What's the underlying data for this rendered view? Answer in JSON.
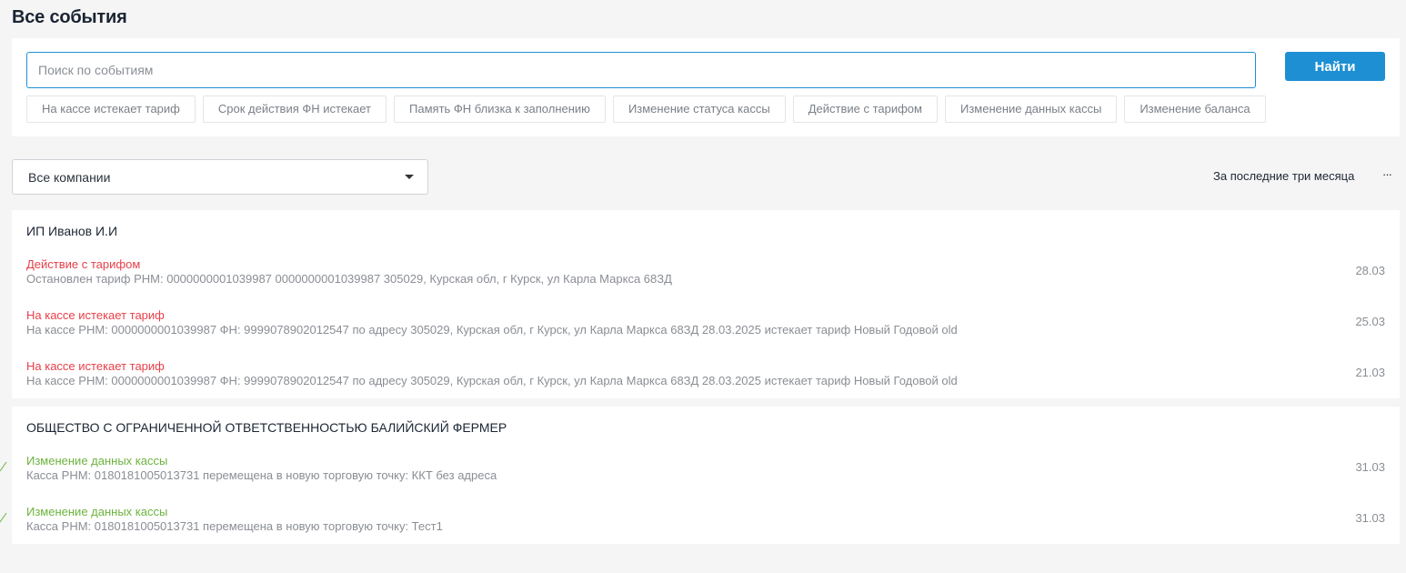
{
  "page_title": "Все события",
  "search": {
    "placeholder": "Поиск по событиям",
    "value": "",
    "button_label": "Найти"
  },
  "filter_chips": [
    "На кассе истекает тариф",
    "Срок действия ФН истекает",
    "Память ФН близка к заполнению",
    "Изменение статуса кассы",
    "Действие с тарифом",
    "Изменение данных кассы",
    "Изменение баланса"
  ],
  "company_select": {
    "selected": "Все компании"
  },
  "period": {
    "label": "За последние три месяца",
    "more_glyph": "···"
  },
  "colors": {
    "accent": "#1e8fd3",
    "event_red": "#e8404a",
    "event_green": "#6cb33e"
  },
  "groups": [
    {
      "title": "ИП Иванов И.И",
      "events": [
        {
          "type": "Действие с тарифом",
          "description": "Остановлен тариф РНМ: 0000000001039987 0000000001039987 305029, Курская обл, г Курск, ул Карла Маркса 68ЗД",
          "date": "28.03",
          "color": "red"
        },
        {
          "type": "На кассе истекает тариф",
          "description": "На кассе РНМ: 0000000001039987 ФН: 9999078902012547 по адресу 305029, Курская обл, г Курск, ул Карла Маркса 68ЗД 28.03.2025 истекает тариф Новый Годовой old",
          "date": "25.03",
          "color": "red"
        },
        {
          "type": "На кассе истекает тариф",
          "description": "На кассе РНМ: 0000000001039987 ФН: 9999078902012547 по адресу 305029, Курская обл, г Курск, ул Карла Маркса 68ЗД 28.03.2025 истекает тариф Новый Годовой old",
          "date": "21.03",
          "color": "red"
        }
      ]
    },
    {
      "title": "ОБЩЕСТВО С ОГРАНИЧЕННОЙ ОТВЕТСТВЕННОСТЬЮ БАЛИЙСКИЙ ФЕРМЕР",
      "events": [
        {
          "type": "Изменение данных кассы",
          "description": "Касса РНМ: 0180181005013731 перемещена в новую торговую точку: ККТ без адреса",
          "date": "31.03",
          "color": "green"
        },
        {
          "type": "Изменение данных кассы",
          "description": "Касса РНМ: 0180181005013731 перемещена в новую торговую точку: Тест1",
          "date": "31.03",
          "color": "green"
        }
      ]
    }
  ]
}
